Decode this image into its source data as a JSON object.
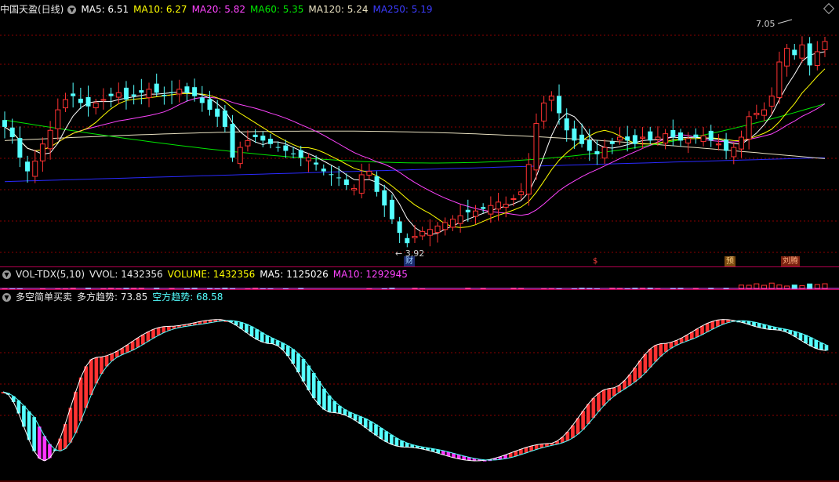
{
  "main_legend": {
    "title": "中国天盈(日线)",
    "ma5": "MA5: 6.51",
    "ma10": "MA10: 6.27",
    "ma20": "MA20: 5.82",
    "ma60": "MA60: 5.35",
    "ma120": "MA120: 5.24",
    "ma250": "MA250: 5.19"
  },
  "price_labels": {
    "high": "7.05",
    "low": "3.92"
  },
  "markers": {
    "cai": "财",
    "s": "$",
    "yu": "预",
    "liu": "刘腾"
  },
  "vol_legend": {
    "name": "VOL-TDX(5,10)",
    "vvol": "VVOL: 1432356",
    "volume": "VOLUME: 1432356",
    "ma5": "MA5: 1125026",
    "ma10": "MA10: 1292945"
  },
  "ind_legend": {
    "name": "多空简单买卖",
    "bull": "多方趋势: 73.85",
    "bear": "空方趋势: 68.58"
  },
  "colors": {
    "up": "#ff3232",
    "down": "#54ffff",
    "ma5": "#ffffff",
    "ma10": "#ffff00",
    "ma20": "#ff44ff",
    "ma60": "#00e600",
    "ma120": "#e8e0c0",
    "ma250": "#2a2aff",
    "grid": "#8b0000",
    "separator": "#b4004e"
  },
  "chart_data": {
    "type": "candlestick",
    "ylim": [
      3.7,
      7.3
    ],
    "closes": [
      5.65,
      5.5,
      5.2,
      5.0,
      5.15,
      5.4,
      5.6,
      5.9,
      6.05,
      6.1,
      6.0,
      5.95,
      6.0,
      6.05,
      6.1,
      6.15,
      6.05,
      6.1,
      6.15,
      6.2,
      6.15,
      6.1,
      6.15,
      6.2,
      6.15,
      6.1,
      6.0,
      5.9,
      5.8,
      5.65,
      5.2,
      5.35,
      5.45,
      5.5,
      5.45,
      5.4,
      5.35,
      5.3,
      5.25,
      5.2,
      5.2,
      5.1,
      5.0,
      4.95,
      4.9,
      4.8,
      4.75,
      4.95,
      5.0,
      4.7,
      4.5,
      4.3,
      4.1,
      3.95,
      4.05,
      4.12,
      4.15,
      4.2,
      4.25,
      4.3,
      4.35,
      4.4,
      4.42,
      4.45,
      4.5,
      4.55,
      4.52,
      4.6,
      4.7,
      5.1,
      5.7,
      6.0,
      6.1,
      5.85,
      5.6,
      5.45,
      5.4,
      5.3,
      5.25,
      5.35,
      5.4,
      5.5,
      5.45,
      5.4,
      5.5,
      5.45,
      5.5,
      5.55,
      5.5,
      5.45,
      5.48,
      5.5,
      5.52,
      5.45,
      5.4,
      5.3,
      5.35,
      5.5,
      5.8,
      5.85,
      5.9,
      6.1,
      6.6,
      6.8,
      6.7,
      6.85,
      6.55,
      6.75,
      6.9
    ]
  }
}
